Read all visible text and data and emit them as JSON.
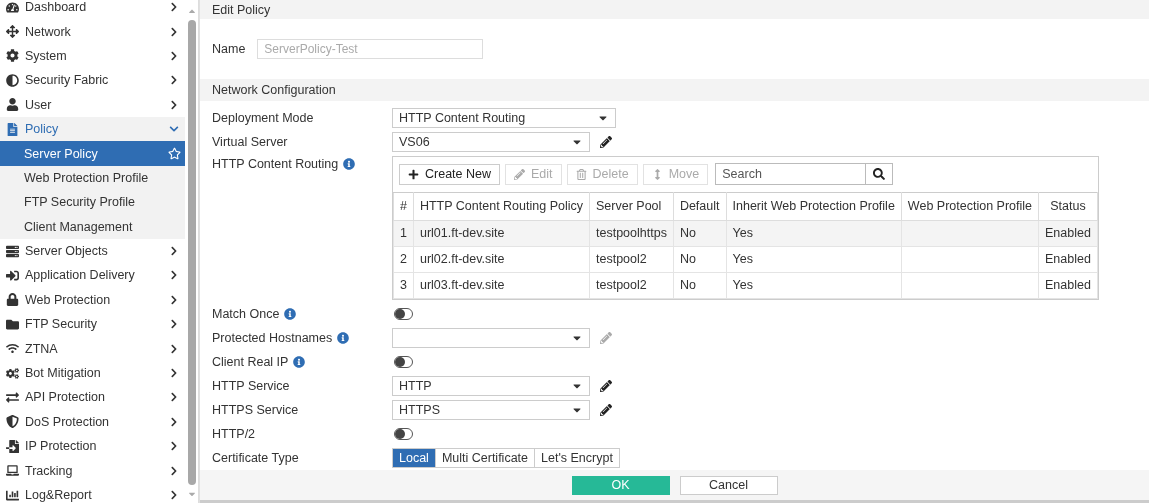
{
  "sidebar": {
    "items": [
      {
        "label": "Dashboard",
        "expanded": false
      },
      {
        "label": "Network",
        "expanded": false
      },
      {
        "label": "System",
        "expanded": false
      },
      {
        "label": "Security Fabric",
        "expanded": false
      },
      {
        "label": "User",
        "expanded": false
      },
      {
        "label": "Policy",
        "expanded": true,
        "children": [
          {
            "label": "Server Policy",
            "selected": true
          },
          {
            "label": "Web Protection Profile",
            "selected": false
          },
          {
            "label": "FTP Security Profile",
            "selected": false
          },
          {
            "label": "Client Management",
            "selected": false
          }
        ]
      },
      {
        "label": "Server Objects",
        "expanded": false
      },
      {
        "label": "Application Delivery",
        "expanded": false
      },
      {
        "label": "Web Protection",
        "expanded": false
      },
      {
        "label": "FTP Security",
        "expanded": false
      },
      {
        "label": "ZTNA",
        "expanded": false
      },
      {
        "label": "Bot Mitigation",
        "expanded": false
      },
      {
        "label": "API Protection",
        "expanded": false
      },
      {
        "label": "DoS Protection",
        "expanded": false
      },
      {
        "label": "IP Protection",
        "expanded": false
      },
      {
        "label": "Tracking",
        "expanded": false
      },
      {
        "label": "Log&Report",
        "expanded": false
      }
    ]
  },
  "panel": {
    "title": "Edit Policy",
    "name_field": {
      "label": "Name",
      "value": "ServerPolicy-Test",
      "disabled": true
    },
    "section": "Network Configuration",
    "fields": [
      {
        "kind": "select",
        "label": "Deployment Mode",
        "value": "HTTP Content Routing",
        "wide": true
      },
      {
        "kind": "select",
        "label": "Virtual Server",
        "value": "VS06",
        "editable": true
      },
      {
        "kind": "table",
        "label": "HTTP Content Routing",
        "info": true,
        "toolbar": [
          {
            "label": "Create New",
            "disabled": false
          },
          {
            "label": "Edit",
            "disabled": true
          },
          {
            "label": "Delete",
            "disabled": true
          },
          {
            "label": "Move",
            "disabled": true
          }
        ],
        "search": {
          "placeholder": "Search"
        },
        "columns": [
          "#",
          "HTTP Content Routing Policy",
          "Server Pool",
          "Default",
          "Inherit Web Protection Profile",
          "Web Protection Profile",
          "Status"
        ],
        "rows": [
          [
            "1",
            "url01.ft-dev.site",
            "testpoolhttps",
            "No",
            "Yes",
            "",
            "Enabled"
          ],
          [
            "2",
            "url02.ft-dev.site",
            "testpool2",
            "No",
            "Yes",
            "",
            "Enabled"
          ],
          [
            "3",
            "url03.ft-dev.site",
            "testpool2",
            "No",
            "Yes",
            "",
            "Enabled"
          ]
        ]
      },
      {
        "kind": "toggle",
        "label": "Match Once",
        "info": true,
        "on": false
      },
      {
        "kind": "select",
        "label": "Protected Hostnames",
        "info": true,
        "editable": false
      },
      {
        "kind": "toggle",
        "label": "Client Real IP",
        "info": true,
        "on": false
      },
      {
        "kind": "select",
        "label": "HTTP Service",
        "value": "HTTP",
        "editable": true
      },
      {
        "kind": "select",
        "label": "HTTPS Service",
        "value": "HTTPS",
        "editable": true
      },
      {
        "kind": "toggle",
        "label": "HTTP/2",
        "on": false
      },
      {
        "kind": "segmented",
        "label": "Certificate Type",
        "options": [
          {
            "label": "Local",
            "selected": true
          },
          {
            "label": "Multi Certificate",
            "selected": false
          },
          {
            "label": "Let's Encrypt",
            "selected": false
          }
        ]
      }
    ],
    "buttons": [
      {
        "label": "OK",
        "kind": "primary"
      },
      {
        "label": "Cancel",
        "kind": "secondary"
      }
    ]
  }
}
